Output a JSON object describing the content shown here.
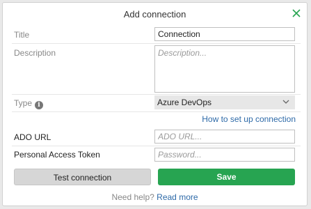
{
  "dialog": {
    "title": "Add connection",
    "close_icon": "close-x-icon"
  },
  "form": {
    "title_label": "Title",
    "title_value": "Connection",
    "description_label": "Description",
    "description_placeholder": "Description...",
    "type_label": "Type",
    "type_info_icon": "info-icon",
    "type_value": "Azure DevOps",
    "setup_link": "How to set up connection",
    "ado_url_label": "ADO URL",
    "ado_url_placeholder": "ADO URL...",
    "pat_label": "Personal Access Token",
    "pat_placeholder": "Password..."
  },
  "actions": {
    "test_label": "Test connection",
    "save_label": "Save"
  },
  "footer": {
    "help_text": "Need help?",
    "read_more": "Read more"
  },
  "colors": {
    "accent_green": "#27a451",
    "link_blue": "#2e6aa8",
    "close_green": "#27a451"
  }
}
